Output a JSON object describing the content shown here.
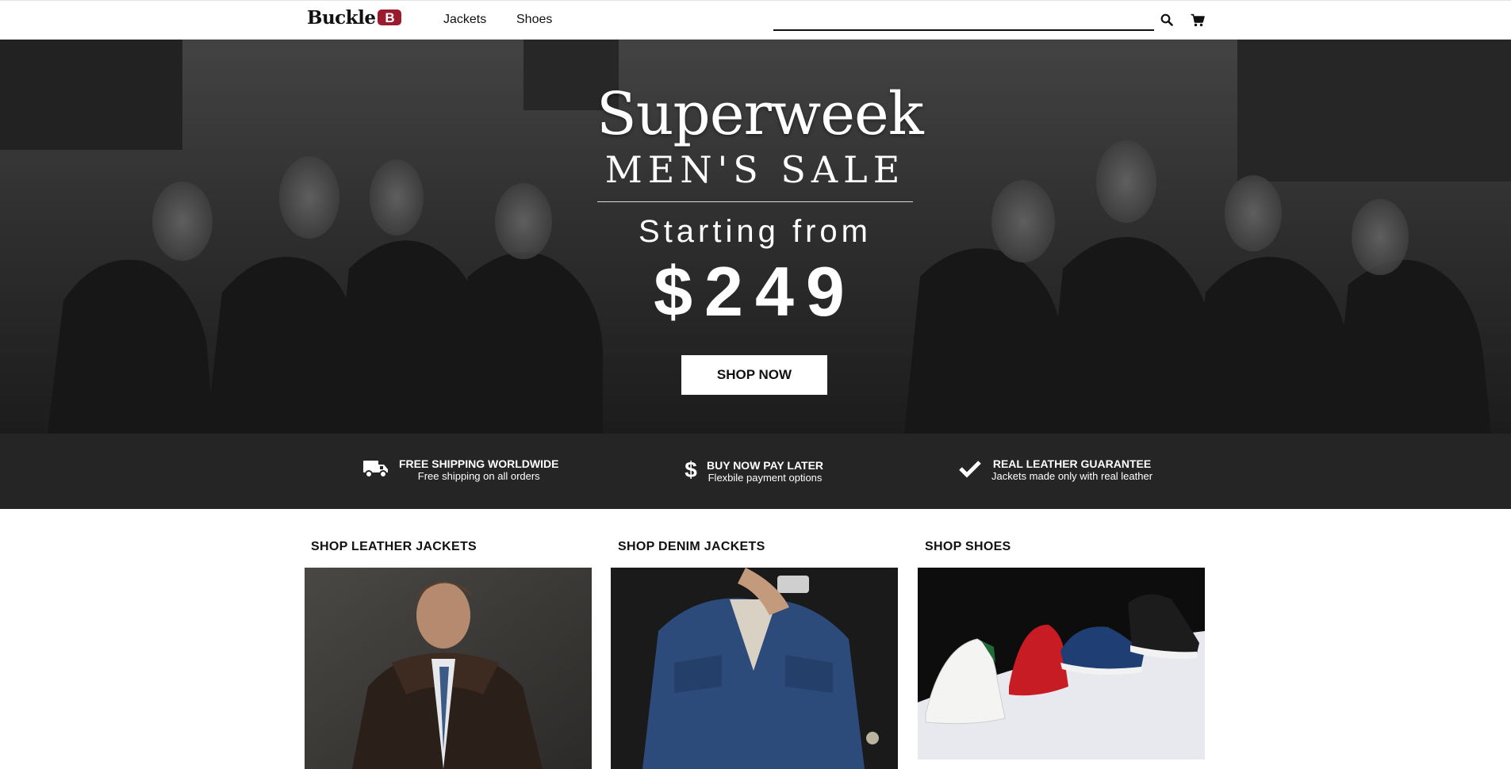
{
  "header": {
    "logo_text": "Buckle",
    "logo_badge": "B",
    "nav": [
      "Jackets",
      "Shoes"
    ],
    "search": {
      "placeholder": "",
      "value": ""
    },
    "icons": [
      "search-icon",
      "cart-icon"
    ]
  },
  "hero": {
    "title": "Superweek",
    "subtitle": "MEN'S SALE",
    "starting_label": "Starting from",
    "price": "$249",
    "cta": "SHOP NOW"
  },
  "features": [
    {
      "icon": "truck-icon",
      "title": "FREE SHIPPING WORLDWIDE",
      "subtitle": "Free shipping on all orders"
    },
    {
      "icon": "dollar-icon",
      "title": "BUY NOW PAY LATER",
      "subtitle": "Flexbile payment options"
    },
    {
      "icon": "checkmark-icon",
      "title": "REAL LEATHER GUARANTEE",
      "subtitle": "Jackets made only with real leather"
    }
  ],
  "categories": [
    {
      "title": "SHOP LEATHER JACKETS"
    },
    {
      "title": "SHOP DENIM JACKETS"
    },
    {
      "title": "SHOP SHOES"
    }
  ],
  "colors": {
    "header_bg": "#ffffff",
    "hero_overlay": "#3a3a3a",
    "features_bg": "#252525",
    "logo_badge": "#9b1b2e",
    "cta_bg": "#ffffff"
  }
}
